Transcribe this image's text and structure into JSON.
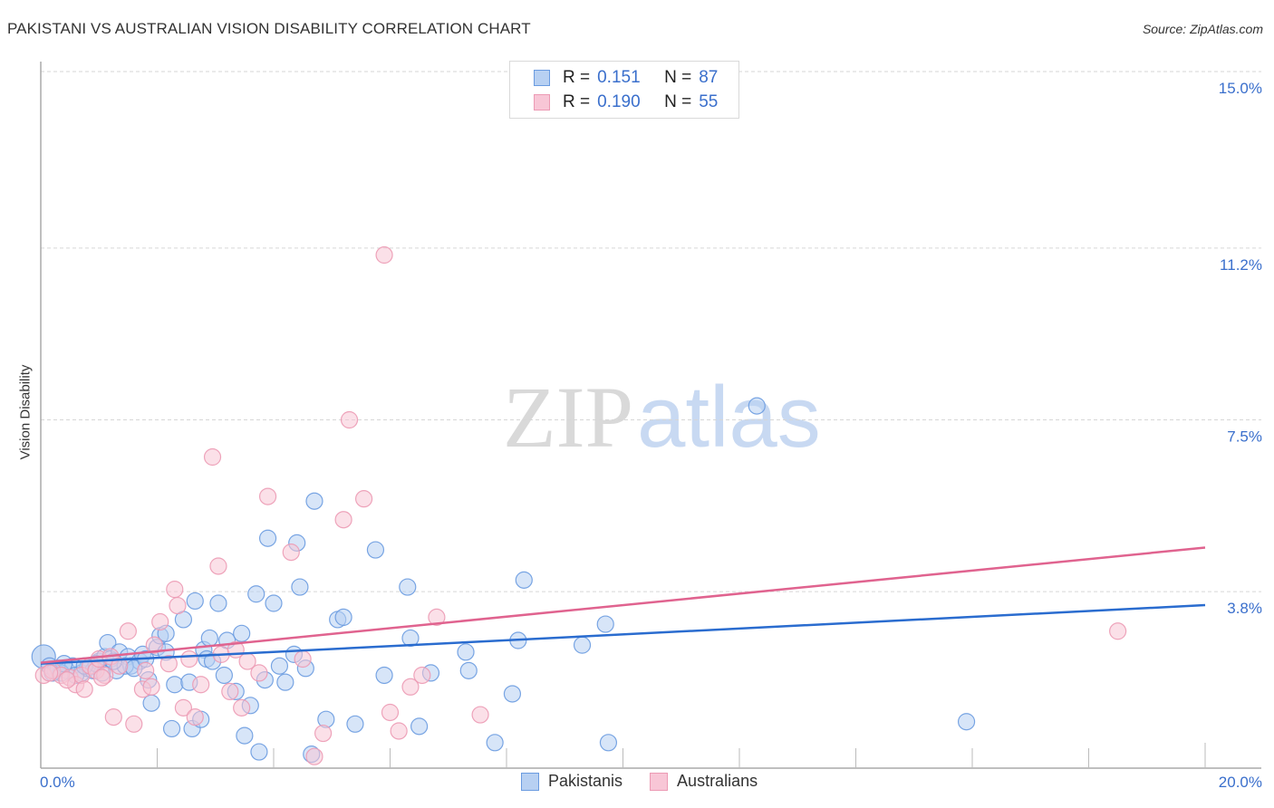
{
  "header": {
    "title": "PAKISTANI VS AUSTRALIAN VISION DISABILITY CORRELATION CHART",
    "source": "Source: ZipAtlas.com"
  },
  "watermark": {
    "zip": "ZIP",
    "atlas": "atlas"
  },
  "legend": {
    "rows": [
      {
        "r_label": "R =",
        "r_value": "0.151",
        "n_label": "N =",
        "n_value": "87"
      },
      {
        "r_label": "R =",
        "r_value": "0.190",
        "n_label": "N =",
        "n_value": "55"
      }
    ]
  },
  "bottom_legend": [
    "Pakistanis",
    "Australians"
  ],
  "chart_data": {
    "type": "scatter",
    "title": "PAKISTANI VS AUSTRALIAN VISION DISABILITY CORRELATION CHART",
    "xlabel": "",
    "ylabel": "Vision Disability",
    "xlim": [
      0,
      20
    ],
    "ylim": [
      0,
      15.0
    ],
    "x_tick_labels": [
      "0.0%",
      "20.0%"
    ],
    "y_ticks": [
      3.8,
      7.5,
      11.2,
      15.0
    ],
    "y_tick_labels": [
      "3.8%",
      "7.5%",
      "11.2%",
      "15.0%"
    ],
    "grid": true,
    "legend_position": "top-center",
    "series": [
      {
        "name": "Pakistanis",
        "color": "#6a9be0",
        "fill": "#b7d0f2",
        "line_color": "#2a6ccf",
        "R": 0.151,
        "N": 87,
        "trend": {
          "x": [
            0,
            20
          ],
          "y": [
            2.25,
            3.51
          ]
        },
        "points": [
          [
            0.05,
            2.4
          ],
          [
            0.15,
            2.2
          ],
          [
            0.25,
            2.1
          ],
          [
            0.3,
            2.15
          ],
          [
            0.45,
            2.1
          ],
          [
            0.55,
            2.2
          ],
          [
            0.7,
            2.05
          ],
          [
            0.8,
            2.15
          ],
          [
            0.9,
            2.1
          ],
          [
            1.0,
            2.3
          ],
          [
            1.1,
            2.4
          ],
          [
            1.2,
            2.35
          ],
          [
            1.15,
            2.7
          ],
          [
            1.3,
            2.1
          ],
          [
            1.35,
            2.5
          ],
          [
            1.5,
            2.4
          ],
          [
            1.55,
            2.2
          ],
          [
            1.7,
            2.3
          ],
          [
            1.75,
            2.45
          ],
          [
            1.85,
            1.9
          ],
          [
            1.9,
            1.4
          ],
          [
            2.0,
            2.6
          ],
          [
            2.05,
            2.85
          ],
          [
            2.15,
            2.5
          ],
          [
            2.25,
            0.85
          ],
          [
            2.3,
            1.8
          ],
          [
            2.45,
            3.2
          ],
          [
            2.55,
            1.85
          ],
          [
            2.6,
            0.85
          ],
          [
            2.65,
            3.6
          ],
          [
            2.75,
            1.05
          ],
          [
            2.8,
            2.55
          ],
          [
            2.85,
            2.35
          ],
          [
            2.9,
            2.8
          ],
          [
            3.05,
            3.55
          ],
          [
            3.15,
            2.0
          ],
          [
            3.2,
            2.75
          ],
          [
            3.35,
            1.65
          ],
          [
            3.45,
            2.9
          ],
          [
            3.5,
            0.7
          ],
          [
            3.6,
            1.35
          ],
          [
            3.7,
            3.75
          ],
          [
            3.75,
            0.35
          ],
          [
            3.85,
            1.9
          ],
          [
            3.9,
            4.95
          ],
          [
            4.0,
            3.55
          ],
          [
            4.1,
            2.2
          ],
          [
            4.2,
            1.85
          ],
          [
            4.35,
            2.45
          ],
          [
            4.4,
            4.85
          ],
          [
            4.45,
            3.9
          ],
          [
            4.55,
            2.15
          ],
          [
            4.65,
            0.3
          ],
          [
            4.7,
            5.75
          ],
          [
            4.9,
            1.05
          ],
          [
            5.1,
            3.2
          ],
          [
            5.2,
            3.25
          ],
          [
            5.4,
            0.95
          ],
          [
            5.75,
            4.7
          ],
          [
            5.9,
            2.0
          ],
          [
            6.3,
            3.9
          ],
          [
            6.35,
            2.8
          ],
          [
            6.5,
            0.9
          ],
          [
            6.7,
            2.05
          ],
          [
            7.3,
            2.5
          ],
          [
            7.35,
            2.1
          ],
          [
            7.8,
            0.55
          ],
          [
            8.1,
            1.6
          ],
          [
            8.2,
            2.75
          ],
          [
            8.3,
            4.05
          ],
          [
            9.3,
            2.65
          ],
          [
            9.7,
            3.1
          ],
          [
            9.75,
            0.55
          ],
          [
            12.3,
            7.8
          ],
          [
            15.9,
            1.0
          ],
          [
            0.6,
            2.0
          ],
          [
            1.45,
            2.2
          ],
          [
            2.15,
            2.9
          ],
          [
            0.35,
            2.05
          ],
          [
            1.05,
            2.05
          ],
          [
            1.6,
            2.15
          ],
          [
            0.2,
            2.05
          ],
          [
            0.95,
            2.25
          ],
          [
            2.95,
            2.3
          ],
          [
            1.25,
            2.3
          ],
          [
            0.75,
            2.2
          ],
          [
            1.8,
            2.35
          ],
          [
            0.4,
            2.25
          ]
        ]
      },
      {
        "name": "Australians",
        "color": "#ec9ab4",
        "fill": "#f8c6d6",
        "line_color": "#e0638f",
        "R": 0.19,
        "N": 55,
        "trend": {
          "x": [
            0,
            20
          ],
          "y": [
            2.27,
            4.75
          ]
        },
        "points": [
          [
            0.05,
            2.0
          ],
          [
            0.2,
            2.1
          ],
          [
            0.35,
            2.0
          ],
          [
            0.5,
            1.95
          ],
          [
            0.6,
            1.8
          ],
          [
            0.7,
            2.0
          ],
          [
            0.75,
            1.7
          ],
          [
            0.85,
            2.2
          ],
          [
            0.95,
            2.1
          ],
          [
            1.0,
            2.35
          ],
          [
            1.1,
            2.0
          ],
          [
            1.2,
            2.4
          ],
          [
            1.25,
            1.1
          ],
          [
            1.35,
            2.2
          ],
          [
            1.5,
            2.95
          ],
          [
            1.6,
            0.95
          ],
          [
            1.75,
            1.7
          ],
          [
            1.8,
            2.1
          ],
          [
            1.9,
            1.75
          ],
          [
            1.95,
            2.65
          ],
          [
            2.05,
            3.15
          ],
          [
            2.2,
            2.25
          ],
          [
            2.3,
            3.85
          ],
          [
            2.35,
            3.5
          ],
          [
            2.45,
            1.3
          ],
          [
            2.55,
            2.35
          ],
          [
            2.65,
            1.1
          ],
          [
            2.75,
            1.8
          ],
          [
            2.95,
            6.7
          ],
          [
            3.05,
            4.35
          ],
          [
            3.1,
            2.45
          ],
          [
            3.25,
            1.65
          ],
          [
            3.35,
            2.55
          ],
          [
            3.45,
            1.3
          ],
          [
            3.55,
            2.3
          ],
          [
            3.75,
            2.05
          ],
          [
            3.9,
            5.85
          ],
          [
            4.3,
            4.65
          ],
          [
            4.5,
            2.35
          ],
          [
            4.7,
            0.25
          ],
          [
            4.85,
            0.75
          ],
          [
            5.2,
            5.35
          ],
          [
            5.3,
            7.5
          ],
          [
            5.55,
            5.8
          ],
          [
            5.9,
            11.05
          ],
          [
            6.0,
            1.2
          ],
          [
            6.15,
            0.8
          ],
          [
            6.35,
            1.75
          ],
          [
            6.55,
            2.0
          ],
          [
            6.8,
            3.25
          ],
          [
            7.55,
            1.15
          ],
          [
            18.5,
            2.95
          ],
          [
            0.45,
            1.9
          ],
          [
            1.05,
            1.95
          ],
          [
            0.15,
            2.05
          ]
        ]
      }
    ]
  }
}
